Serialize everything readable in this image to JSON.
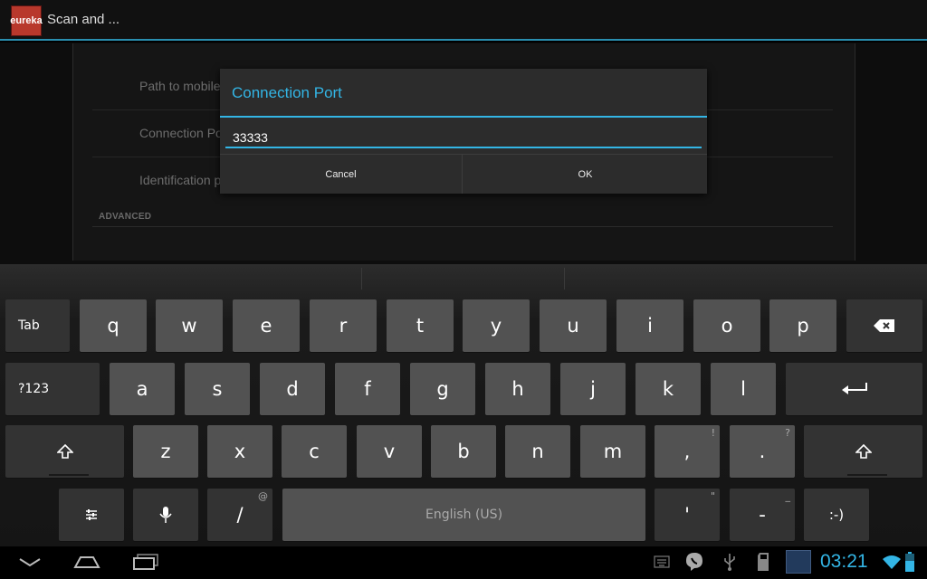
{
  "app": {
    "icon_text": "eureka",
    "title": "Scan and ..."
  },
  "settings": {
    "items": [
      {
        "label": "Path to mobile"
      },
      {
        "label": "Connection Po"
      },
      {
        "label": "Identification p"
      }
    ],
    "section": "ADVANCED"
  },
  "dialog": {
    "title": "Connection Port",
    "input_value": "33333",
    "cancel_label": "Cancel",
    "ok_label": "OK"
  },
  "keyboard": {
    "row1": [
      "q",
      "w",
      "e",
      "r",
      "t",
      "y",
      "u",
      "i",
      "o",
      "p"
    ],
    "row2": [
      "a",
      "s",
      "d",
      "f",
      "g",
      "h",
      "j",
      "k",
      "l"
    ],
    "row3": [
      "z",
      "x",
      "c",
      "v",
      "b",
      "n",
      "m",
      ",",
      "."
    ],
    "row3_hints": [
      "!",
      "?"
    ],
    "tab_label": "Tab",
    "symbols_label": "?123",
    "space_label": "English (US)",
    "slash_label": "/",
    "slash_hint": "@",
    "apostrophe_label": "'",
    "apostrophe_hint": "\"",
    "dash_label": "-",
    "dash_hint": "_",
    "smiley_label": ":-)"
  },
  "status": {
    "time": "03:21",
    "colors": {
      "accent": "#33b5e5",
      "key": "#525252",
      "key_dark": "#333333"
    }
  }
}
